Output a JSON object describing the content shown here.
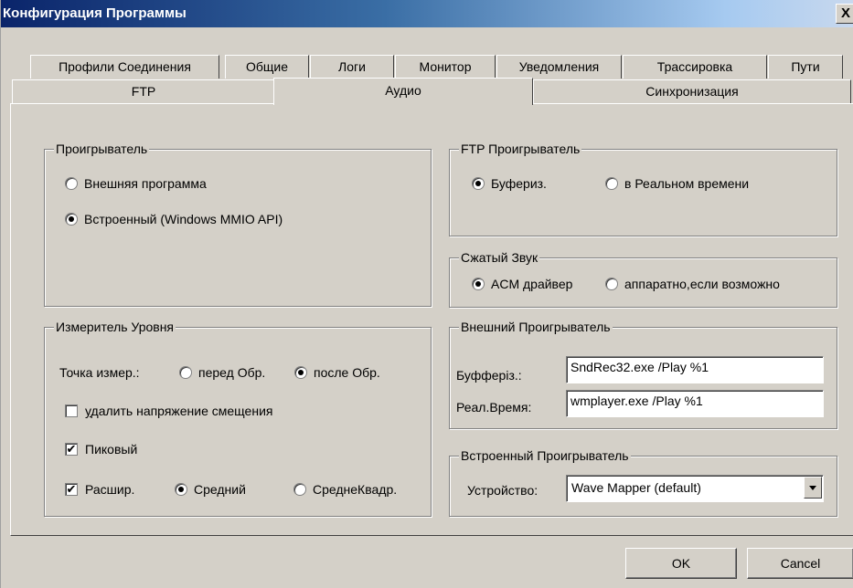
{
  "window": {
    "title": "Конфигурация Программы",
    "close_glyph": "X"
  },
  "tabs_row1": [
    "Профили Соединения",
    "Общие",
    "Логи",
    "Монитор",
    "Уведомления",
    "Трассировка",
    "Пути"
  ],
  "tabs_row2": [
    "FTP",
    "Аудио",
    "Синхронизация"
  ],
  "active_tab": "Аудио",
  "player": {
    "legend": "Проигрыватель",
    "options": [
      "Внешняя программа",
      "Встроенный (Windows MMIO API)"
    ],
    "selected": "Встроенный (Windows MMIO API)"
  },
  "ftp_player": {
    "legend": "FTP Проигрыватель",
    "options": [
      "Буфериз.",
      "в Реальном времени"
    ],
    "selected": "Буфериз."
  },
  "compressed": {
    "legend": "Сжатый Звук",
    "options": [
      "ACM драйвер",
      "аппаратно,если возможно"
    ],
    "selected": "ACM драйвер"
  },
  "meter": {
    "legend": "Измеритель Уровня",
    "point_label": "Точка измер.:",
    "point_options": [
      "перед Обр.",
      "после Обр."
    ],
    "point_selected": "после Обр.",
    "remove_offset": {
      "prefix": "у",
      "rest": "далить напряжение смещения",
      "checked": false
    },
    "peak": {
      "label": "Пиковый",
      "checked": true
    },
    "extended": {
      "label": "Расшир.",
      "checked": true
    },
    "mode_options": [
      "Средний",
      "СреднеКвадр."
    ],
    "mode_selected": "Средний",
    "check_glyph": "✔"
  },
  "external_player": {
    "legend": "Внешний Проигрыватель",
    "buffered_label": "Буфферiз.:",
    "buffered_value": "SndRec32.exe /Play %1",
    "realtime_label": "Реал.Время:",
    "realtime_value": "wmplayer.exe /Play %1"
  },
  "builtin_player": {
    "legend": "Встроенный Проигрыватель",
    "device_label": "Устройство:",
    "device_value": "Wave Mapper (default)"
  },
  "buttons": {
    "ok": "OK",
    "cancel": "Cancel"
  }
}
